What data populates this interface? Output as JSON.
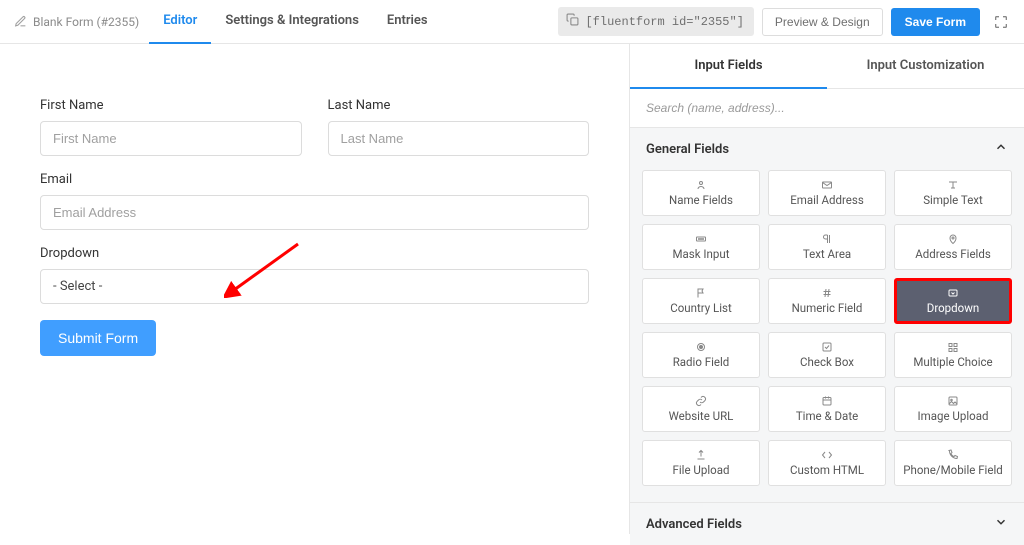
{
  "header": {
    "form_title": "Blank Form (#2355)",
    "tabs": {
      "editor": "Editor",
      "settings": "Settings & Integrations",
      "entries": "Entries"
    },
    "shortcode": "[fluentform id=\"2355\"]",
    "preview_label": "Preview & Design",
    "save_label": "Save Form"
  },
  "form": {
    "first_name": {
      "label": "First Name",
      "placeholder": "First Name"
    },
    "last_name": {
      "label": "Last Name",
      "placeholder": "Last Name"
    },
    "email": {
      "label": "Email",
      "placeholder": "Email Address"
    },
    "dropdown": {
      "label": "Dropdown",
      "selected": "- Select -"
    },
    "submit_label": "Submit Form"
  },
  "panel": {
    "tabs": {
      "input_fields": "Input Fields",
      "customization": "Input Customization"
    },
    "search_placeholder": "Search (name, address)...",
    "sections": {
      "general": "General Fields",
      "advanced": "Advanced Fields"
    },
    "tiles": {
      "name_fields": "Name Fields",
      "email_address": "Email Address",
      "simple_text": "Simple Text",
      "mask_input": "Mask Input",
      "text_area": "Text Area",
      "address_fields": "Address Fields",
      "country_list": "Country List",
      "numeric_field": "Numeric Field",
      "dropdown": "Dropdown",
      "radio_field": "Radio Field",
      "check_box": "Check Box",
      "multiple_choice": "Multiple Choice",
      "website_url": "Website URL",
      "time_date": "Time & Date",
      "image_upload": "Image Upload",
      "file_upload": "File Upload",
      "custom_html": "Custom HTML",
      "phone_mobile": "Phone/Mobile Field"
    }
  }
}
